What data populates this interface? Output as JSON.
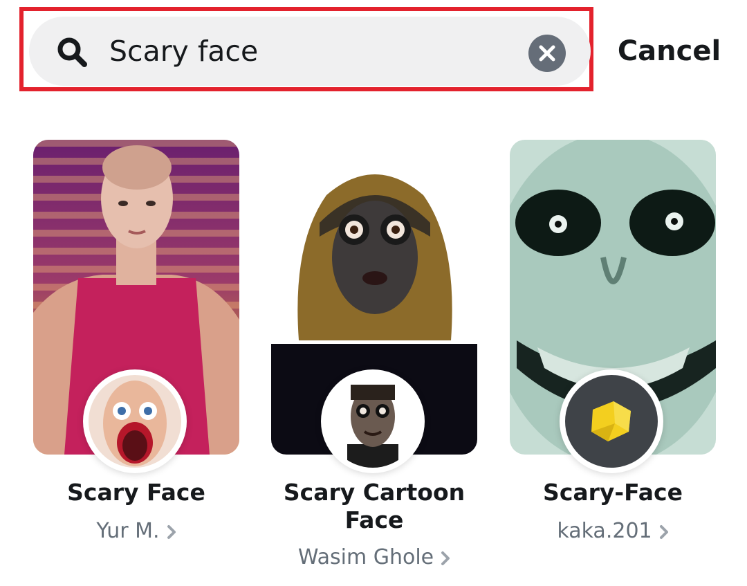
{
  "search": {
    "value": "Scary face",
    "placeholder": "",
    "cancel_label": "Cancel"
  },
  "lenses": [
    {
      "name": "Scary Face",
      "creator": "Yur M."
    },
    {
      "name": "Scary Cartoon Face",
      "creator": "Wasim Ghole"
    },
    {
      "name": "Scary-Face",
      "creator": "kaka.201"
    }
  ],
  "icons": {
    "search": "search-icon",
    "clear": "close-icon",
    "chevron": "chevron-right-icon"
  },
  "colors": {
    "highlight": "#e3222d",
    "search_bg": "#f0f0f1",
    "text_primary": "#16191c",
    "text_secondary": "#646e78",
    "clear_bg": "#656d78"
  }
}
